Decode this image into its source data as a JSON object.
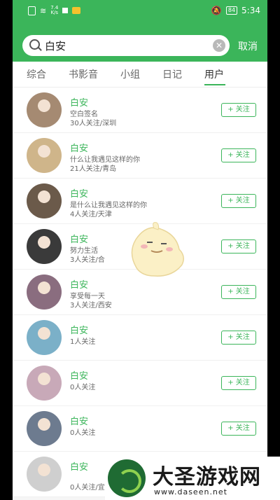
{
  "status_bar": {
    "time": "5:34",
    "battery": "84",
    "speed_top": "7.4",
    "speed_bottom": "K/s"
  },
  "search": {
    "value": "白安",
    "cancel_label": "取消"
  },
  "tabs": [
    "综合",
    "书影音",
    "小组",
    "日记",
    "用户"
  ],
  "active_tab": "用户",
  "follow_label": "+ 关注",
  "results": [
    {
      "name": "白安",
      "line1": "空白签名",
      "line2": "30人关注/深圳"
    },
    {
      "name": "白安",
      "line1": "什么让我遇见这样的你",
      "line2": "21人关注/青岛"
    },
    {
      "name": "白安",
      "line1": "是什么让我遇见这样的你",
      "line2": "4人关注/天津"
    },
    {
      "name": "白安",
      "line1": "努力生活",
      "line2": "3人关注/合"
    },
    {
      "name": "白安",
      "line1": "享受每一天",
      "line2": "3人关注/西安"
    },
    {
      "name": "白安",
      "line1": "1人关注",
      "line2": ""
    },
    {
      "name": "白安",
      "line1": "0人关注",
      "line2": ""
    },
    {
      "name": "白安",
      "line1": "0人关注",
      "line2": ""
    },
    {
      "name": "白安",
      "line1": "",
      "line2": "0人关注/宜"
    }
  ],
  "avatar_colors": [
    "#a58a72",
    "#cfb58a",
    "#6b5a4a",
    "#3a3a3a",
    "#8a6d7f",
    "#7bb0c8",
    "#c8a9b8",
    "#6d7b8f",
    "#cfcfcf"
  ],
  "watermark": {
    "title": "大圣游戏网",
    "url": "www.daseen.net"
  }
}
